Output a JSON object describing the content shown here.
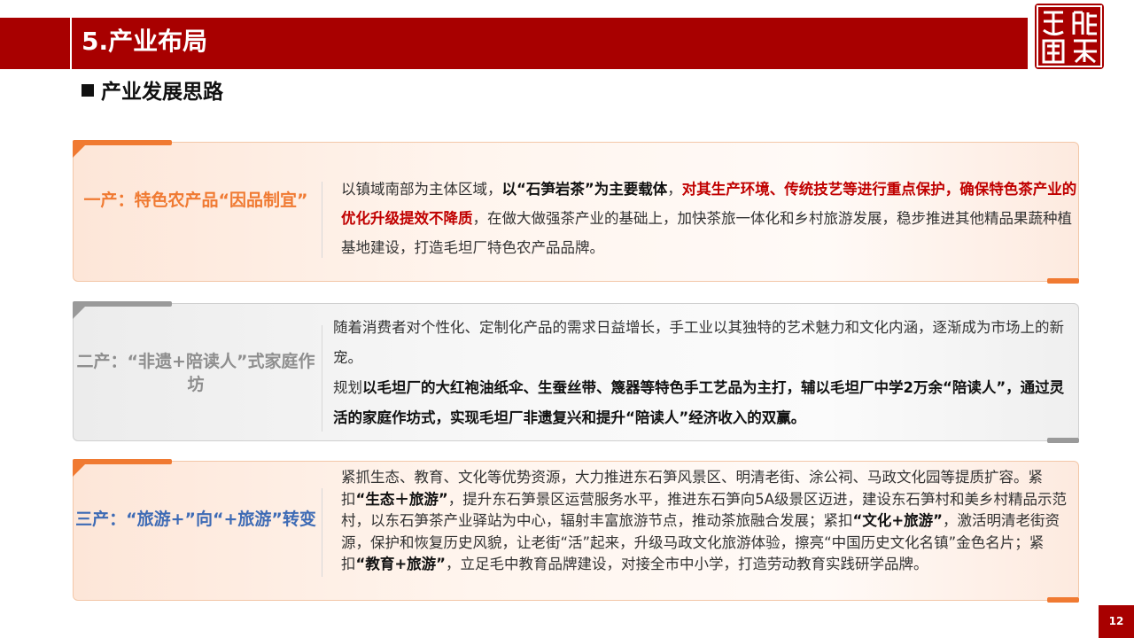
{
  "header": {
    "title": "5.产业布局"
  },
  "subtitle": "产业发展思路",
  "colors": {
    "brand_red": "#a80000",
    "orange": "#f07a32",
    "blue": "#3e6bb5",
    "gray": "#8e8e8e",
    "highlight_red": "#c00000"
  },
  "cards": [
    {
      "label": "一产：特色农产品“因品制宜”",
      "text": [
        {
          "t": "以镇域南部为主体区域，",
          "s": "n"
        },
        {
          "t": "以“石笋岩茶”为主要载体",
          "s": "b"
        },
        {
          "t": "，",
          "s": "n"
        },
        {
          "t": "对其生产环境、传统技艺等进行重点保护，确保特色茶产业的优化升级提效不降质",
          "s": "r"
        },
        {
          "t": "，在做大做强茶产业的基础上，加快茶旅一体化和乡村旅游发展，稳步推进其他精品果蔬种植基地建设，打造毛坦厂特色农产品品牌。",
          "s": "n"
        }
      ]
    },
    {
      "label": "二产：“非遗+陪读人”式家庭作坊",
      "text": [
        {
          "t": "随着消费者对个性化、定制化产品的需求日益增长，手工业以其独特的艺术魅力和文化内涵，逐渐成为市场上的新宠。",
          "s": "n"
        },
        {
          "t": "\n",
          "s": "br"
        },
        {
          "t": "规划",
          "s": "n"
        },
        {
          "t": "以毛坦厂的大红袍油纸伞、生蚕丝带、篾器等特色手工艺品为主打，辅以毛坦厂中学2万余“陪读人”，通过灵活的家庭作坊式，实现毛坦厂非遗复兴和提升“陪读人”经济收入的双赢。",
          "s": "b"
        }
      ]
    },
    {
      "label": "三产：“旅游+”向“+旅游”转变",
      "text": [
        {
          "t": "紧抓生态、教育、文化等优势资源，大力推进东石笋风景区、明清老街、涂公祠、马政文化园等提质扩容。紧扣",
          "s": "n"
        },
        {
          "t": "“生态＋旅游”",
          "s": "b"
        },
        {
          "t": "，提升东石笋景区运营服务水平，推进东石笋向5A级景区迈进，建设东石笋村和美乡村精品示范村，以东石笋茶产业驿站为中心，辐射丰富旅游节点，推动茶旅融合发展；紧扣",
          "s": "n"
        },
        {
          "t": "“文化+旅游”",
          "s": "b"
        },
        {
          "t": "，激活明清老街资源，保护和恢复历史风貌，让老街“活”起来，升级马政文化旅游体验，擦亮“中国历史文化名镇”金色名片；紧扣",
          "s": "n"
        },
        {
          "t": "“教育+旅游”",
          "s": "b"
        },
        {
          "t": "，立足毛中教育品牌建设，对接全市中小学，打造劳动教育实践研学品牌。",
          "s": "n"
        }
      ]
    }
  ],
  "page_number": "12"
}
